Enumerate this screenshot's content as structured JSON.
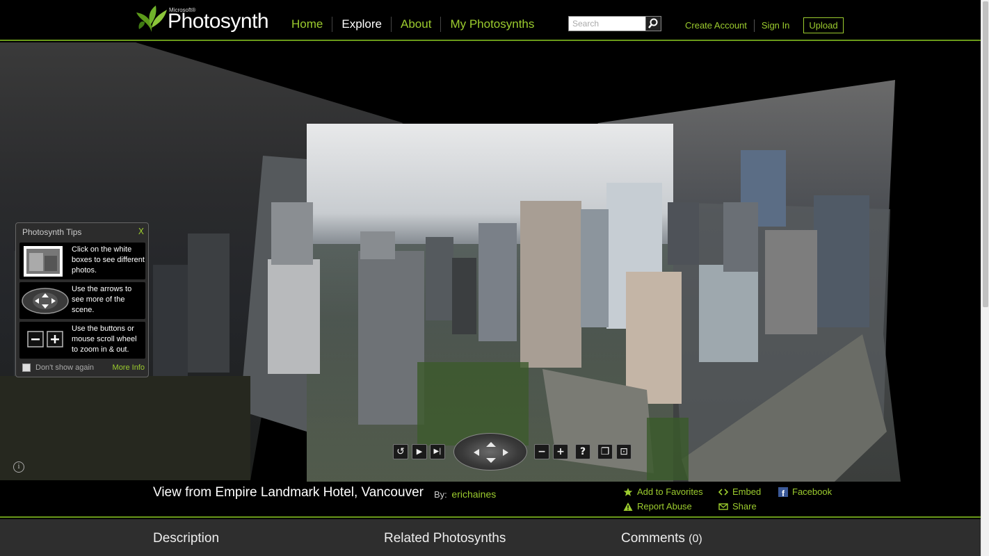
{
  "header": {
    "logo_small": "Microsoft®",
    "logo_word": "Photosynth",
    "nav": [
      {
        "label": "Home",
        "active": false
      },
      {
        "label": "Explore",
        "active": true
      },
      {
        "label": "About",
        "active": false
      },
      {
        "label": "My Photosynths",
        "active": false
      }
    ],
    "search": {
      "placeholder": "Search",
      "value": "",
      "icon": "search-icon"
    },
    "account": {
      "create": "Create Account",
      "sign_in": "Sign In",
      "upload": "Upload"
    }
  },
  "tips": {
    "title": "Photosynth Tips",
    "close": "X",
    "items": [
      {
        "text": "Click on the white boxes to see different photos.",
        "icon": "photo-thumbnail-icon"
      },
      {
        "text": "Use the arrows to see more of the scene.",
        "icon": "arrow-pad-icon"
      },
      {
        "text": "Use the buttons or mouse scroll wheel to zoom in & out.",
        "icon": "zoom-buttons-icon"
      }
    ],
    "dont_show": "Don't show again",
    "more_info": "More Info"
  },
  "viewer_controls": {
    "info": "i",
    "rotate": "↺",
    "play": "▶",
    "next": "▶|",
    "zoom_out": "−",
    "zoom_in": "+",
    "help": "?",
    "overlay": "❐",
    "fullscreen": "⊡"
  },
  "synth": {
    "title": "View from Empire Landmark Hotel, Vancouver",
    "by_label": "By:",
    "author": "erichaines"
  },
  "actions": {
    "favorites": "Add to Favorites",
    "embed": "Embed",
    "facebook": "Facebook",
    "report": "Report Abuse",
    "share": "Share"
  },
  "sections": {
    "description": "Description",
    "related": "Related Photosynths",
    "comments": "Comments",
    "comments_count": "(0)"
  },
  "colors": {
    "accent": "#9ccc2e",
    "border": "#6a9a1a"
  }
}
